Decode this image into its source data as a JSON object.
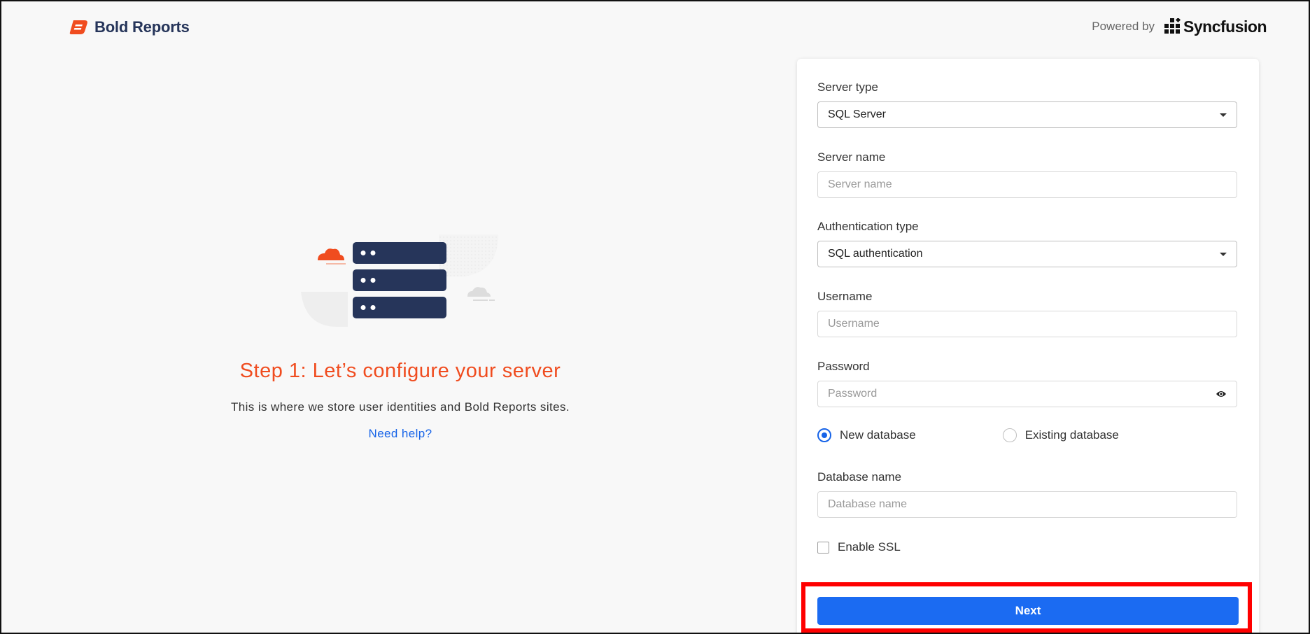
{
  "header": {
    "brand": "Bold Reports",
    "powered_by_label": "Powered by",
    "powered_by_brand": "Syncfusion"
  },
  "colors": {
    "brand_orange": "#f04c1f",
    "brand_navy": "#26355a",
    "primary_blue": "#1b6bf2",
    "link_blue": "#1764e8",
    "highlight_red": "#ff0000"
  },
  "intro": {
    "title": "Step 1: Let’s configure your server",
    "subtitle": "This is where we store user identities and Bold Reports sites.",
    "help_link": "Need help?"
  },
  "form": {
    "server_type": {
      "label": "Server type",
      "value": "SQL Server"
    },
    "server_name": {
      "label": "Server name",
      "placeholder": "Server name"
    },
    "auth_type": {
      "label": "Authentication type",
      "value": "SQL authentication"
    },
    "username": {
      "label": "Username",
      "placeholder": "Username"
    },
    "password": {
      "label": "Password",
      "placeholder": "Password"
    },
    "database_mode": {
      "options": [
        "New database",
        "Existing database"
      ],
      "selected": "New database"
    },
    "database_name": {
      "label": "Database name",
      "placeholder": "Database name"
    },
    "enable_ssl": {
      "label": "Enable SSL",
      "checked": false
    },
    "next_label": "Next"
  },
  "icons": {
    "brand_logo": "bold-reports-logo-icon",
    "syncfusion_logo": "syncfusion-logo-icon",
    "illustration": "server-illustration",
    "dropdown": "chevron-down-icon",
    "password_toggle": "eye-icon"
  }
}
